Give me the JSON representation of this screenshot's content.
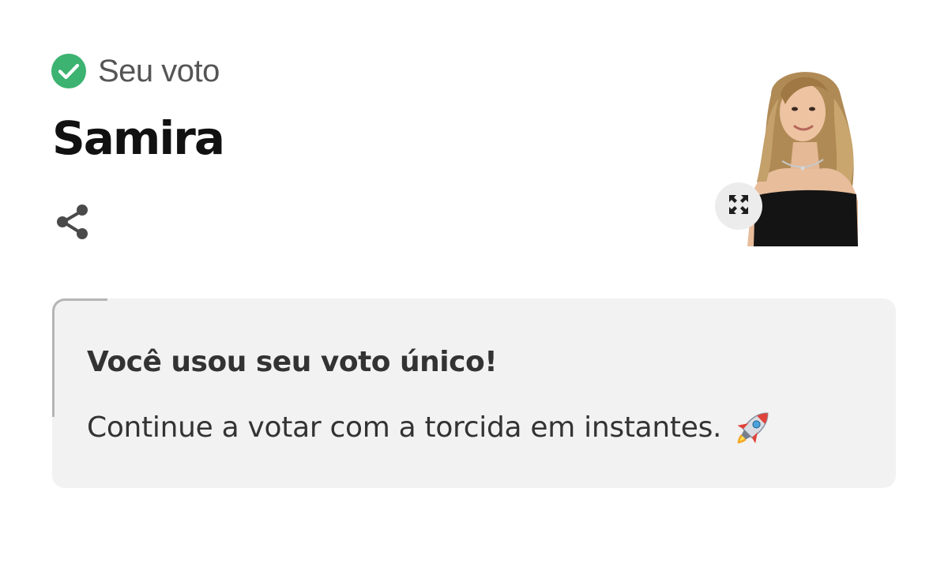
{
  "vote": {
    "header_label": "Seu voto",
    "header_icon": "check-circle-icon",
    "candidate_name": "Samira",
    "share_icon": "share-icon",
    "expand_icon": "expand-icon"
  },
  "notice": {
    "title": "Você usou seu voto único!",
    "body": "Continue a votar com a torcida em instantes.",
    "emoji_icon": "rocket-icon"
  },
  "colors": {
    "check_green": "#3cb371",
    "card_background": "#f2f2f2",
    "text_dark": "#111111",
    "text_muted": "#555555"
  }
}
